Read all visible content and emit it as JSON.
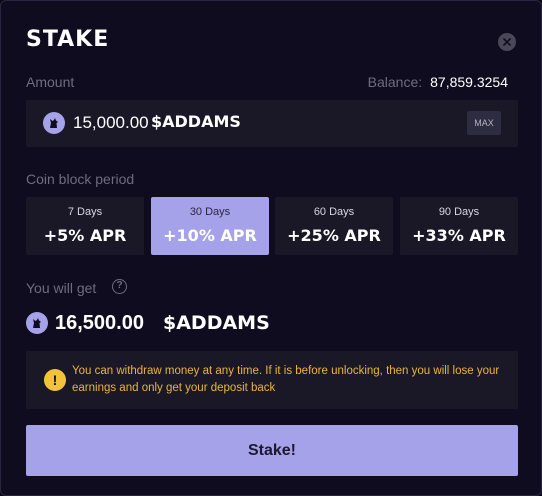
{
  "modal": {
    "title": "STAKE",
    "close_icon": "close-icon"
  },
  "amount": {
    "label": "Amount",
    "balance_label": "Balance:",
    "balance_value": "87,859.3254",
    "value": "15,000.00",
    "ticker": "$ADDAMS",
    "max_label": "MAX",
    "coin_icon": "wolf-coin-icon"
  },
  "period": {
    "label": "Coin block period",
    "options": [
      {
        "days": "7 Days",
        "apr": "+5% APR",
        "selected": false
      },
      {
        "days": "30 Days",
        "apr": "+10% APR",
        "selected": true
      },
      {
        "days": "60 Days",
        "apr": "+25% APR",
        "selected": false
      },
      {
        "days": "90 Days",
        "apr": "+33% APR",
        "selected": false
      }
    ]
  },
  "result": {
    "label": "You will get",
    "help_icon": "question-icon",
    "value": "16,500.00",
    "ticker": "$ADDAMS"
  },
  "warning": {
    "icon": "exclamation-icon",
    "text": "You can withdraw money at any time. If it is before unlocking, then you will lose your earnings and only get your deposit back"
  },
  "actions": {
    "stake_label": "Stake!"
  },
  "colors": {
    "background": "#100c1f",
    "panel": "#1a1727",
    "accent": "#a5a2e9",
    "warning": "#e8b73a"
  }
}
